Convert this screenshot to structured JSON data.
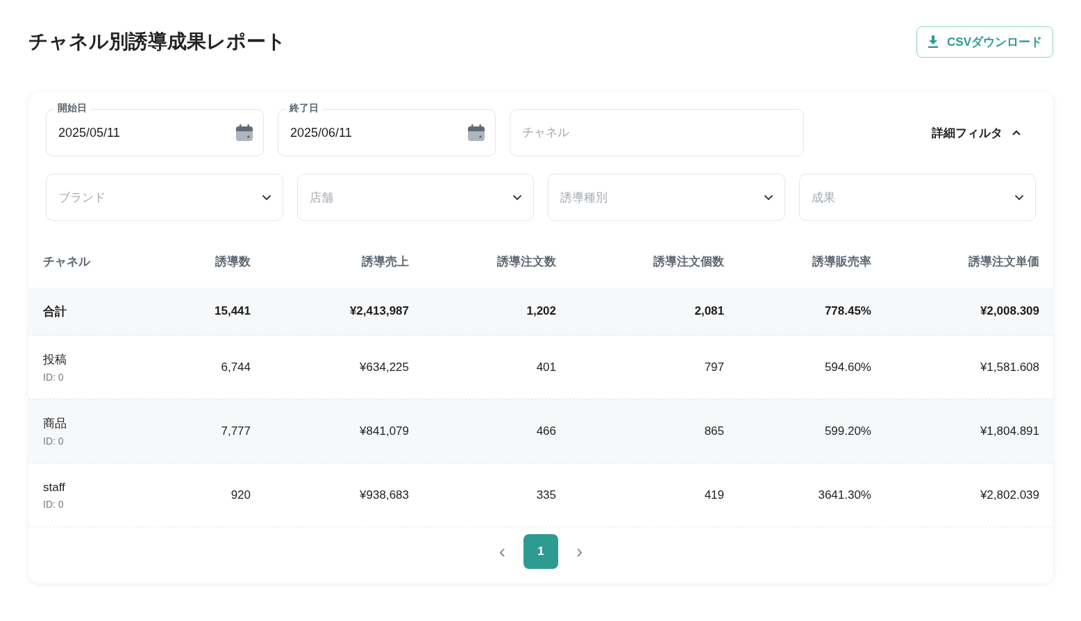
{
  "page": {
    "title": "チャネル別誘導成果レポート",
    "export_button": "CSVダウンロード"
  },
  "filters": {
    "start_date": {
      "label": "開始日",
      "value": "2025/05/11"
    },
    "end_date": {
      "label": "終了日",
      "value": "2025/06/11"
    },
    "channel": {
      "placeholder": "チャネル"
    },
    "advanced_toggle": {
      "label": "詳細フィルタ",
      "expanded": true
    },
    "selects": [
      {
        "placeholder": "ブランド"
      },
      {
        "placeholder": "店舗"
      },
      {
        "placeholder": "誘導種別"
      },
      {
        "placeholder": "成果"
      }
    ]
  },
  "table": {
    "columns": [
      "チャネル",
      "誘導数",
      "誘導売上",
      "誘導注文数",
      "誘導注文個数",
      "誘導販売率",
      "誘導注文単価"
    ],
    "total": {
      "label": "合計",
      "values": [
        "15,441",
        "¥2,413,987",
        "1,202",
        "2,081",
        "778.45%",
        "¥2,008.309"
      ]
    },
    "rows": [
      {
        "name": "投稿",
        "id": "ID: 0",
        "values": [
          "6,744",
          "¥634,225",
          "401",
          "797",
          "594.60%",
          "¥1,581.608"
        ]
      },
      {
        "name": "商品",
        "id": "ID: 0",
        "values": [
          "7,777",
          "¥841,079",
          "466",
          "865",
          "599.20%",
          "¥1,804.891"
        ]
      },
      {
        "name": "staff",
        "id": "ID: 0",
        "values": [
          "920",
          "¥938,683",
          "335",
          "419",
          "3641.30%",
          "¥2,802.039"
        ]
      }
    ]
  },
  "pagination": {
    "prev": "‹",
    "next": "›",
    "pages": [
      {
        "label": "1",
        "selected": true
      }
    ]
  }
}
